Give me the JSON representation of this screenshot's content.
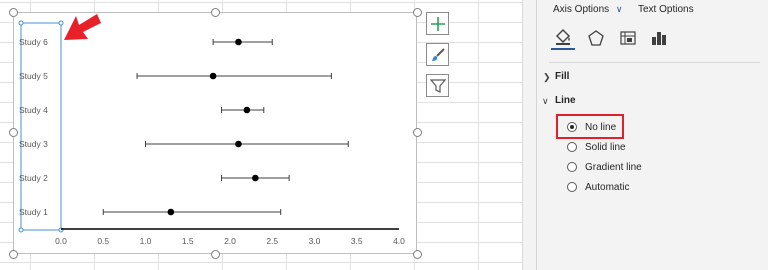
{
  "chart": {
    "studies": [
      "Study 6",
      "Study 5",
      "Study 4",
      "Study 3",
      "Study 2",
      "Study 1"
    ],
    "x_ticks": [
      "0.0",
      "0.5",
      "1.0",
      "1.5",
      "2.0",
      "2.5",
      "3.0",
      "3.5",
      "4.0"
    ]
  },
  "chart_data": {
    "type": "scatter",
    "categories": [
      "Study 6",
      "Study 5",
      "Study 4",
      "Study 3",
      "Study 2",
      "Study 1"
    ],
    "points": [
      {
        "label": "Study 6",
        "x": 2.1,
        "low": 1.8,
        "high": 2.5
      },
      {
        "label": "Study 5",
        "x": 1.8,
        "low": 0.9,
        "high": 3.2
      },
      {
        "label": "Study 4",
        "x": 2.2,
        "low": 1.9,
        "high": 2.4
      },
      {
        "label": "Study 3",
        "x": 2.1,
        "low": 1.0,
        "high": 3.4
      },
      {
        "label": "Study 2",
        "x": 2.3,
        "low": 1.9,
        "high": 2.7
      },
      {
        "label": "Study 1",
        "x": 1.3,
        "low": 0.5,
        "high": 2.6
      }
    ],
    "xlim": [
      0,
      4
    ],
    "grid": false
  },
  "pane": {
    "tab_axis_options": "Axis Options",
    "tab_text_options": "Text Options",
    "section_fill": "Fill",
    "section_line": "Line",
    "line_options": [
      {
        "label": "No line",
        "selected": true
      },
      {
        "label": "Solid line",
        "selected": false
      },
      {
        "label": "Gradient line",
        "selected": false
      },
      {
        "label": "Automatic",
        "selected": false
      }
    ]
  },
  "colors": {
    "highlight": "#e0202a",
    "arrow": "#e8202a",
    "axis_selection": "#4a90d9",
    "plus_icon": "#2e9e5b",
    "tab_accent": "#2b579a"
  }
}
